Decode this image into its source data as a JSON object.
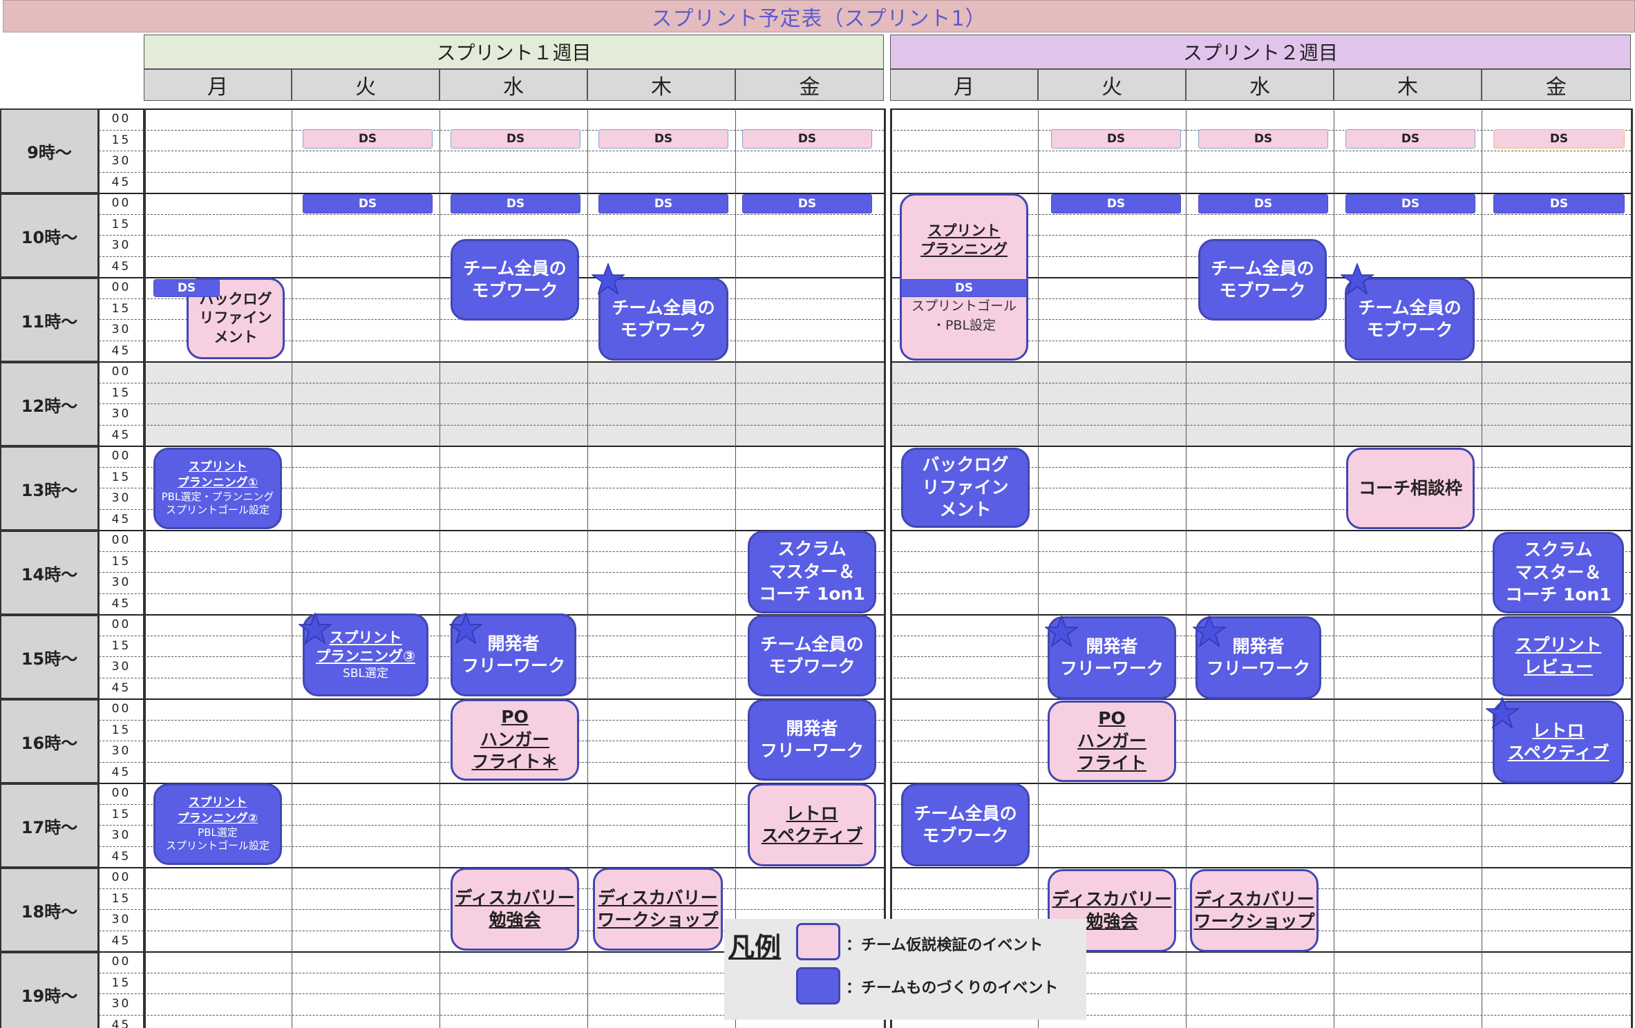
{
  "title": "スプリント予定表（スプリント1）",
  "weeks": [
    {
      "label": "スプリント１週目",
      "color": "#e3ecd9"
    },
    {
      "label": "スプリント２週目",
      "color": "#e1c4ec"
    }
  ],
  "days": [
    "月",
    "火",
    "水",
    "木",
    "金"
  ],
  "hours": [
    "9時〜",
    "10時〜",
    "11時〜",
    "12時〜",
    "13時〜",
    "14時〜",
    "15時〜",
    "16時〜",
    "17時〜",
    "18時〜",
    "19時〜"
  ],
  "minutes": [
    "00",
    "15",
    "30",
    "45"
  ],
  "ds_label": "DS",
  "events": {
    "w1_mon_ds": "DS",
    "w1_mon_backlog": [
      "バックログ",
      "リファイン",
      "メント"
    ],
    "w1_mon_sp1": {
      "title": [
        "スプリント",
        "プランニング①"
      ],
      "sub": [
        "PBL選定・プランニング",
        "スプリントゴール設定"
      ]
    },
    "w1_mon_sp2": {
      "title": [
        "スプリント",
        "プランニング②"
      ],
      "sub": [
        "PBL選定",
        "スプリントゴール設定"
      ]
    },
    "w1_tue_sp3": {
      "title": [
        "スプリント",
        "プランニング③"
      ],
      "sub": [
        "SBL選定"
      ]
    },
    "w1_wed_mob": [
      "チーム全員の",
      "モブワーク"
    ],
    "w1_wed_free": [
      "開発者",
      "フリーワーク"
    ],
    "w1_wed_po": [
      "PO",
      "ハンガー",
      "フライト＊"
    ],
    "w1_wed_disc": [
      "ディスカバリー",
      "勉強会"
    ],
    "w1_thu_mob": [
      "チーム全員の",
      "モブワーク"
    ],
    "w1_thu_disc": [
      "ディスカバリー",
      "ワークショップ"
    ],
    "w1_fri_sm": [
      "スクラム",
      "マスター＆",
      "コーチ 1on1"
    ],
    "w1_fri_mob": [
      "チーム全員の",
      "モブワーク"
    ],
    "w1_fri_free": [
      "開発者",
      "フリーワーク"
    ],
    "w1_fri_retro": [
      "レトロ",
      "スペクティブ"
    ],
    "w2_mon_sp": {
      "title": [
        "スプリント",
        "プランニング"
      ],
      "bar": "DS",
      "sub": [
        "スプリントゴール",
        "・PBL設定"
      ]
    },
    "w2_mon_backlog": [
      "バックログ",
      "リファイン",
      "メント"
    ],
    "w2_mon_mob": [
      "チーム全員の",
      "モブワーク"
    ],
    "w2_tue_free": [
      "開発者",
      "フリーワーク"
    ],
    "w2_tue_po": [
      "PO",
      "ハンガー",
      "フライト"
    ],
    "w2_tue_disc": [
      "ディスカバリー",
      "勉強会"
    ],
    "w2_wed_mob": [
      "チーム全員の",
      "モブワーク"
    ],
    "w2_wed_free": [
      "開発者",
      "フリーワーク"
    ],
    "w2_wed_disc": [
      "ディスカバリー",
      "ワークショップ"
    ],
    "w2_thu_mob": [
      "チーム全員の",
      "モブワーク"
    ],
    "w2_thu_coach": "コーチ相談枠",
    "w2_fri_sm": [
      "スクラム",
      "マスター＆",
      "コーチ 1on1"
    ],
    "w2_fri_review": [
      "スプリント",
      "レビュー"
    ],
    "w2_fri_retro": [
      "レトロ",
      "スペクティブ"
    ]
  },
  "legend": {
    "title": "凡例",
    "pink_label": "：チーム仮説検証のイベント",
    "blue_label": "：チームものづくりのイベント"
  },
  "colors": {
    "pink_event": "#f6cfe0",
    "blue_event": "#5a5ee4",
    "title_bar": "#e5bcbe",
    "title_text": "#5b5bd0",
    "header_gray": "#d9d9d9",
    "lunch_gray": "#e6e6e6"
  }
}
